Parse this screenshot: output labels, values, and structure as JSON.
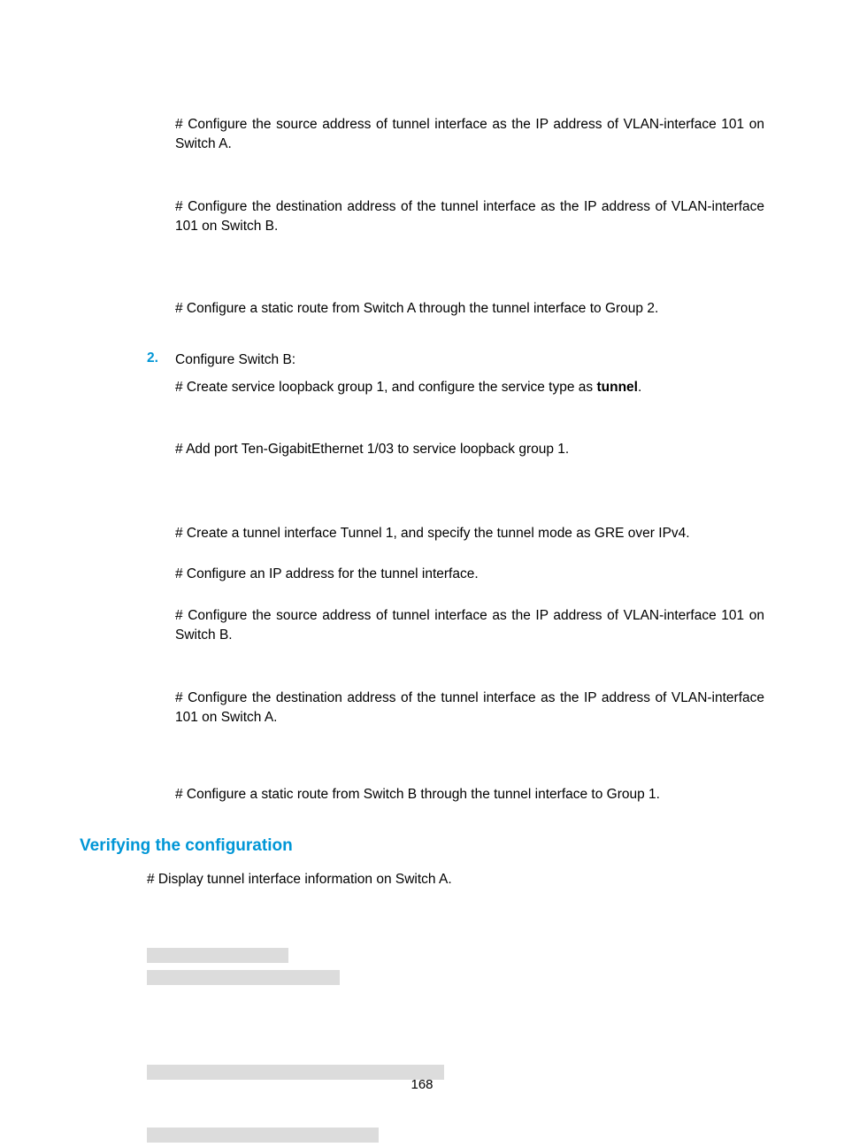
{
  "paragraphs": {
    "p1": "# Configure the source address of tunnel interface as the IP address of VLAN-interface 101 on Switch A.",
    "p2": "# Configure the destination address of the tunnel interface as the IP address of VLAN-interface 101 on Switch B.",
    "p3": "# Configure a static route from Switch A through the tunnel interface to Group 2.",
    "step_num": "2.",
    "step_text": "Configure Switch B:",
    "p4a": "# Create service loopback group 1, and configure the service type as ",
    "p4b": "tunnel",
    "p4c": ".",
    "p5": "# Add port Ten-GigabitEthernet 1/03 to service loopback group 1.",
    "p6": "# Create a tunnel interface Tunnel 1, and specify the tunnel mode as GRE over IPv4.",
    "p7": "# Configure an IP address for the tunnel interface.",
    "p8": "# Configure the source address of tunnel interface as the IP address of VLAN-interface 101 on Switch B.",
    "p9": "# Configure the destination address of the tunnel interface as the IP address of VLAN-interface 101 on Switch A.",
    "p10": "# Configure a static route from Switch B through the tunnel interface to Group 1."
  },
  "heading": "Verifying the configuration",
  "verify_line": "# Display tunnel interface information on Switch A.",
  "page_number": "168"
}
